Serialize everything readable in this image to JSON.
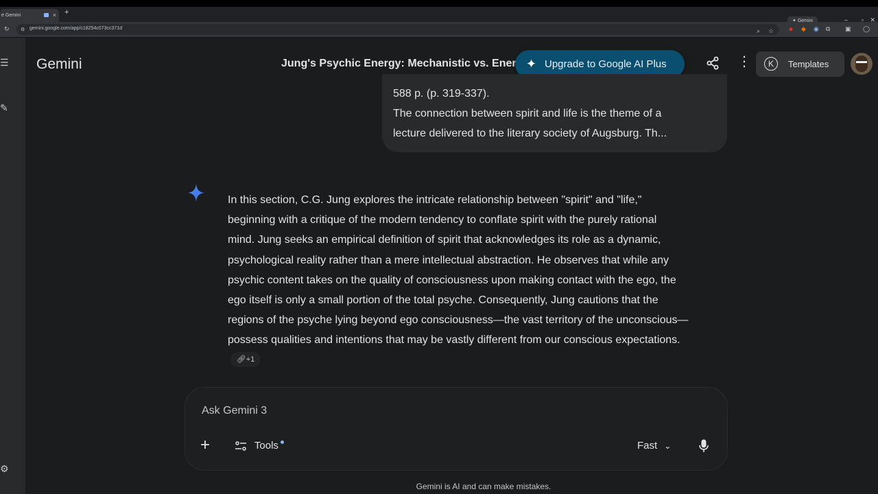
{
  "browser": {
    "tab_title": "e Gemini",
    "tab_close": "×",
    "new_tab": "+",
    "right_tab_label": "Gemini",
    "url": "gemini.google.com/app/c18254c073cc371d"
  },
  "header": {
    "brand": "Gemini",
    "conversation_title": "Jung's Psychic Energy: Mechanistic vs. Ener",
    "upgrade_label": "Upgrade to Google AI Plus",
    "templates_label": "Templates",
    "templates_badge": "K"
  },
  "user_message": {
    "lines": [
      "588 p. (p. 319-337).",
      "The connection between spirit and life is the theme of a",
      "lecture delivered to the literary society of Augsburg. Th..."
    ]
  },
  "response": {
    "lines": [
      "In this section, C.G. Jung explores the intricate relationship between \"spirit\" and \"life,\"",
      "beginning with a critique of the modern tendency to conflate spirit with the purely rational",
      "mind. Jung seeks an empirical definition of spirit that acknowledges its role as a dynamic,",
      "psychological reality rather than a mere intellectual abstraction. He observes that while any",
      "psychic content takes on the quality of consciousness upon making contact with the ego, the",
      "ego itself is only a small portion of the total psyche. Consequently, Jung cautions that the",
      "regions of the psyche lying beyond ego consciousness—the vast territory of the unconscious—",
      "possess qualities and intentions that may be vastly different from our conscious expectations."
    ],
    "sources_label": "+1"
  },
  "input": {
    "placeholder": "Ask Gemini 3",
    "tools_label": "Tools",
    "mode_label": "Fast"
  },
  "footer": {
    "disclaimer": "Gemini is AI and can make mistakes."
  },
  "colors": {
    "background": "#1b1c1d",
    "upgrade_bg": "#0b4f70",
    "gemini_blue": "#4285f4"
  }
}
